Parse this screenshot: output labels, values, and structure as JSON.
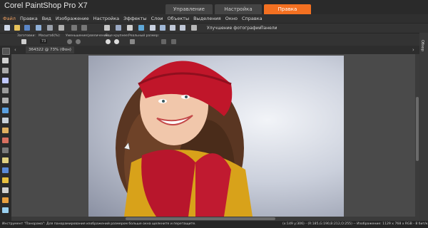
{
  "app": {
    "title": "Corel PaintShop Pro X7"
  },
  "workspace_tabs": [
    {
      "label": "Управление"
    },
    {
      "label": "Настройка"
    },
    {
      "label": "Правка"
    }
  ],
  "menu": [
    {
      "label": "Файл"
    },
    {
      "label": "Правка"
    },
    {
      "label": "Вид"
    },
    {
      "label": "Изображение"
    },
    {
      "label": "Настройка"
    },
    {
      "label": "Эффекты"
    },
    {
      "label": "Слои"
    },
    {
      "label": "Объекты"
    },
    {
      "label": "Выделения"
    },
    {
      "label": "Окно"
    },
    {
      "label": "Справка"
    }
  ],
  "toolbar": {
    "enhance_label": "Улучшение фотографии",
    "panels_label": "Панели"
  },
  "tool_options": {
    "presets_label": "Заготовки:",
    "zoom_label": "Масштаб(%):",
    "zoom_value": "73",
    "zoom_in_out_label": "Уменьшение/увеличение:",
    "zoom_more_label": "Еще крупнее:",
    "actual_size_label": "Реальный размер:"
  },
  "right_panel": {
    "label": "Обзор"
  },
  "document": {
    "tab_label": "364322 @ 73% (Фон)"
  },
  "status": {
    "left": "Инструмент \"Панорама\": Для панорамирования изображений размером больше окна щелкните и перетащите.",
    "right": "(x:149 y:306) - (R:185,G:190,B:212,O:255) -- Изображение: 1129 x 768 x RGB - 8 бит/канал"
  },
  "colors": {
    "accent": "#f37021",
    "background": "#2b2b2b"
  }
}
